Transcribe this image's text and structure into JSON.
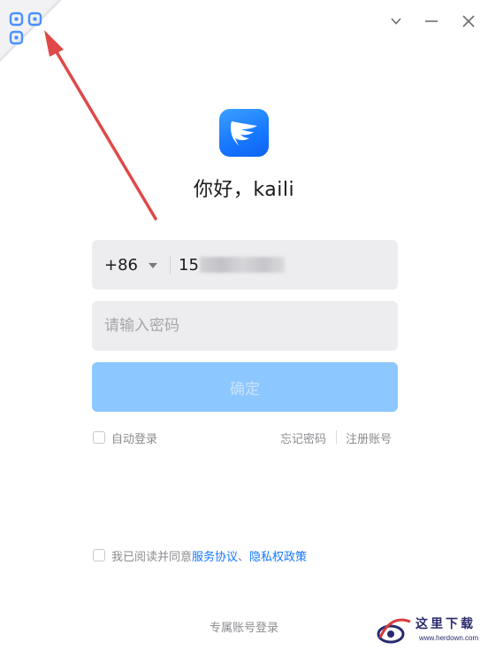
{
  "window_controls": {
    "collapse_icon": "chevron-down-icon",
    "minimize_icon": "minimize-icon",
    "close_icon": "close-icon"
  },
  "qr_toggle": {
    "icon": "qr-code-icon"
  },
  "app": {
    "logo_icon": "feather-wing-logo",
    "greeting": "你好，kaili",
    "accent_color": "#1677ff"
  },
  "login_form": {
    "country_code": "+86",
    "phone_value": "15",
    "password_placeholder": "请输入密码",
    "confirm_label": "确定",
    "auto_login_label": "自动登录",
    "forgot_password_label": "忘记密码",
    "register_label": "注册账号"
  },
  "agreement": {
    "prefix": "我已阅读并同意",
    "service_link": "服务协议",
    "separator": "、",
    "privacy_link": "隐私权政策"
  },
  "footer": {
    "exclusive_login_label": "专属账号登录"
  },
  "watermark": {
    "title": "这里下载",
    "url": "www.herdown.com"
  }
}
